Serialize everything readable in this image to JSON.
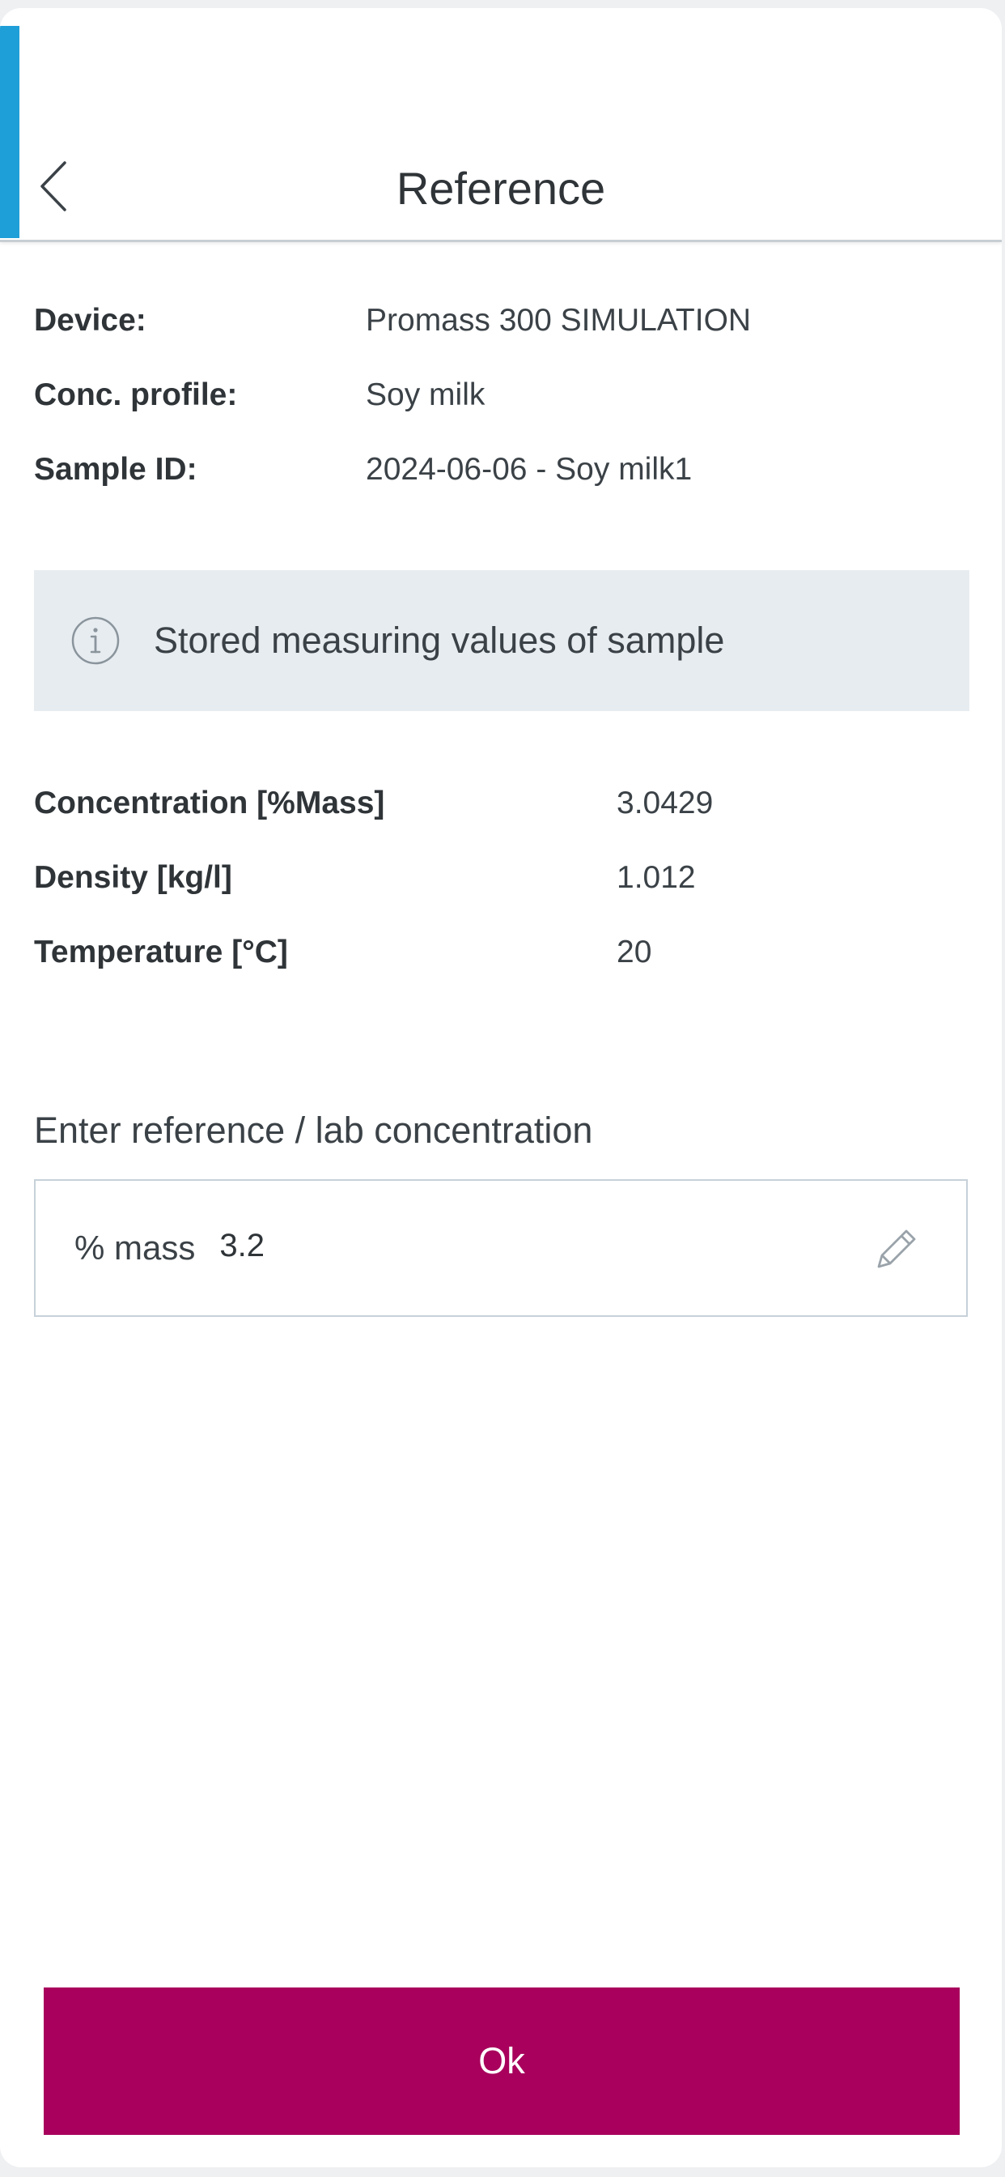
{
  "header": {
    "title": "Reference",
    "accent_color": "#1f9fd8"
  },
  "device_info": [
    {
      "label": "Device:",
      "value": "Promass 300 SIMULATION"
    },
    {
      "label": "Conc. profile:",
      "value": "Soy milk"
    },
    {
      "label": "Sample ID:",
      "value": "2024-06-06 - Soy milk1"
    }
  ],
  "notice": {
    "icon": "info-icon",
    "text": "Stored measuring values of sample"
  },
  "measured_values": [
    {
      "label": "Concentration [%Mass]",
      "value": "3.0429"
    },
    {
      "label": "Density [kg/l]",
      "value": "1.012"
    },
    {
      "label": "Temperature [°C]",
      "value": "20"
    }
  ],
  "reference_entry": {
    "heading": "Enter reference / lab concentration",
    "unit": "% mass",
    "value": "3.2",
    "edit_icon": "pencil-icon"
  },
  "footer": {
    "ok_label": "Ok",
    "button_color": "#a8005c"
  }
}
